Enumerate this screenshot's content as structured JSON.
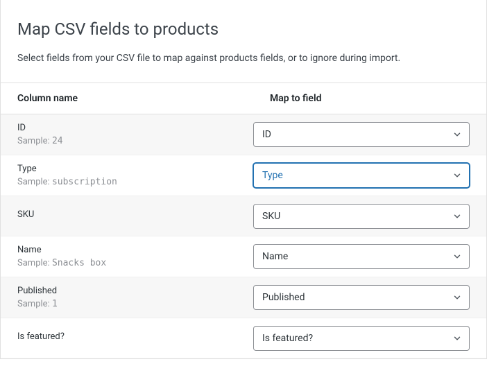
{
  "header": {
    "title": "Map CSV fields to products",
    "subtitle": "Select fields from your CSV file to map against products fields, or to ignore during import."
  },
  "table": {
    "headers": {
      "column_name": "Column name",
      "map_to_field": "Map to field"
    },
    "sample_prefix": "Sample:",
    "rows": [
      {
        "name": "ID",
        "sample": "24",
        "selected": "ID",
        "active": false
      },
      {
        "name": "Type",
        "sample": "subscription",
        "selected": "Type",
        "active": true
      },
      {
        "name": "SKU",
        "sample": null,
        "selected": "SKU",
        "active": false
      },
      {
        "name": "Name",
        "sample": "Snacks box",
        "selected": "Name",
        "active": false
      },
      {
        "name": "Published",
        "sample": "1",
        "selected": "Published",
        "active": false
      },
      {
        "name": "Is featured?",
        "sample": null,
        "selected": "Is featured?",
        "active": false
      }
    ]
  }
}
